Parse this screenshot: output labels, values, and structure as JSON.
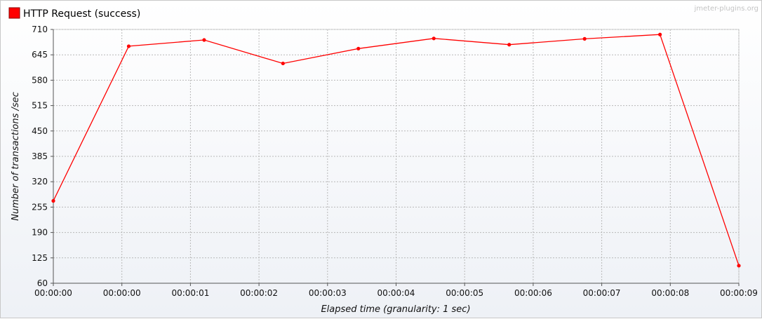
{
  "watermark": "jmeter-plugins.org",
  "chart_data": {
    "type": "line",
    "title": "",
    "xlabel": "Elapsed time (granularity: 1 sec)",
    "ylabel": "Number of transactions /sec",
    "ylim": [
      60,
      710
    ],
    "yticks": [
      60,
      125,
      190,
      255,
      320,
      385,
      450,
      515,
      580,
      645,
      710
    ],
    "xtick_labels": [
      "00:00:00",
      "00:00:00",
      "00:00:01",
      "00:00:02",
      "00:00:03",
      "00:00:04",
      "00:00:05",
      "00:00:06",
      "00:00:07",
      "00:00:08",
      "00:00:09"
    ],
    "grid": true,
    "legend_position": "top-left",
    "series": [
      {
        "name": "HTTP Request (success)",
        "color": "#ff0000",
        "x": [
          0.0,
          1.1,
          2.2,
          3.35,
          4.45,
          5.55,
          6.65,
          7.75,
          8.85,
          10.0
        ],
        "values": [
          271,
          667,
          683,
          623,
          661,
          687,
          671,
          686,
          697,
          105
        ]
      }
    ]
  }
}
